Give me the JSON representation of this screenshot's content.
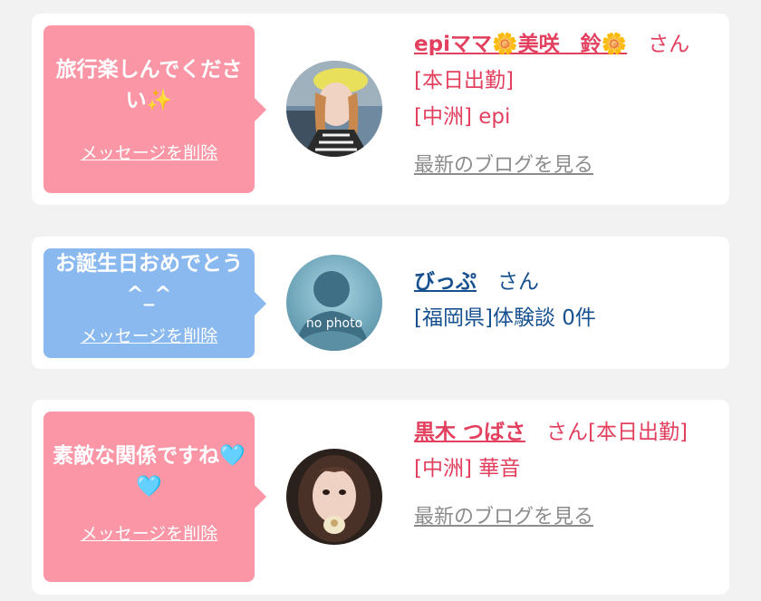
{
  "cards": [
    {
      "message": "旅行楽しんでください✨",
      "delete_label": "メッセージを削除",
      "name": "epiママ🌼美咲　鈴🌼",
      "honorific": "さん",
      "status": "[本日出勤]",
      "location": "[中洲] epi",
      "blog_label": "最新のブログを見る"
    },
    {
      "message": "お誕生日おめでとう^_^",
      "delete_label": "メッセージを削除",
      "name": "びっぷ",
      "honorific": "さん",
      "location": "[福岡県]体験談 0件",
      "avatar_text": "no photo"
    },
    {
      "message": "素敵な関係ですね🩵🩵",
      "delete_label": "メッセージを削除",
      "name": "黒木 つばさ",
      "honorific": "さん",
      "status": "[本日出勤]",
      "location": "[中洲] 華音",
      "blog_label": "最新のブログを見る"
    }
  ],
  "colors": {
    "background": "#f2f2f2",
    "card": "#ffffff",
    "bubble_pink": "#fb96a6",
    "bubble_blue": "#8ab9f0",
    "cast_text": "#e2405e",
    "user_text": "#17508f",
    "link_gray": "#8c8c8c"
  }
}
